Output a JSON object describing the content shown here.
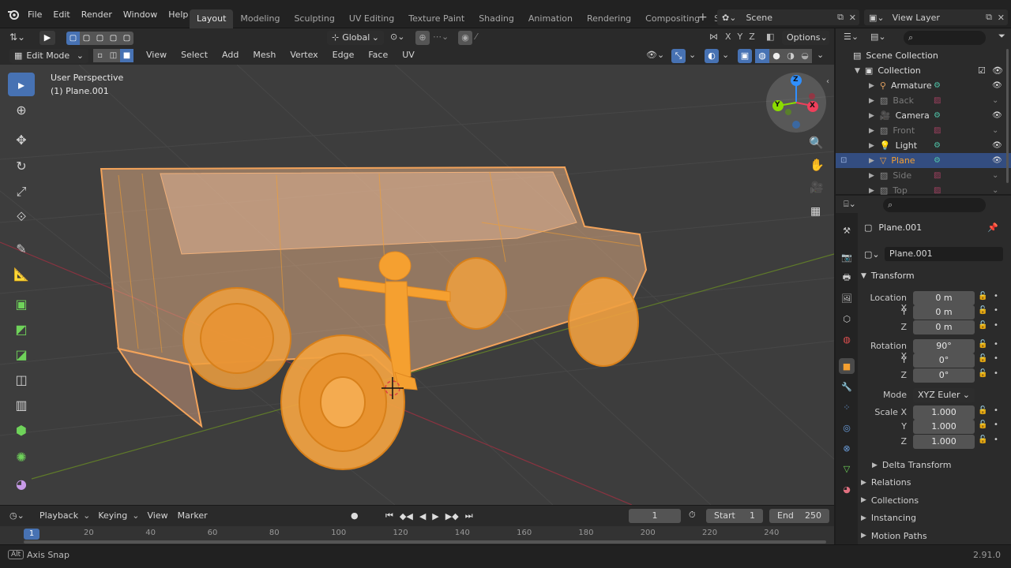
{
  "topbar": {
    "menu": [
      "File",
      "Edit",
      "Render",
      "Window",
      "Help"
    ],
    "workspaces": [
      "Layout",
      "Modeling",
      "Sculpting",
      "UV Editing",
      "Texture Paint",
      "Shading",
      "Animation",
      "Rendering",
      "Compositing",
      "Scripting"
    ],
    "active_workspace": "Layout",
    "add_workspace": "+",
    "scene_label": "Scene",
    "view_layer_label": "View Layer"
  },
  "viewport_toolbar": {
    "transform_orientation": "Global",
    "options_label": "Options",
    "axis_letters": [
      "X",
      "Y",
      "Z"
    ]
  },
  "viewport_header": {
    "mode": "Edit Mode",
    "menus": [
      "View",
      "Select",
      "Add",
      "Mesh",
      "Vertex",
      "Edge",
      "Face",
      "UV"
    ]
  },
  "viewport": {
    "perspective_label": "User Perspective",
    "object_label": "(1) Plane.001",
    "gizmo_axes": [
      "X",
      "Y",
      "Z"
    ]
  },
  "outliner": {
    "scene_collection": "Scene Collection",
    "collection": "Collection",
    "items": [
      {
        "name": "Armature",
        "icon": "armature-icon",
        "color": "#e0a060",
        "dim": false,
        "selected": false
      },
      {
        "name": "Back",
        "icon": "image-icon",
        "color": "#8a8a8a",
        "dim": true,
        "selected": false
      },
      {
        "name": "Camera",
        "icon": "camera-icon",
        "color": "#e0a060",
        "dim": false,
        "selected": false
      },
      {
        "name": "Front",
        "icon": "image-icon",
        "color": "#8a8a8a",
        "dim": true,
        "selected": false
      },
      {
        "name": "Light",
        "icon": "light-icon",
        "color": "#e0a060",
        "dim": false,
        "selected": false
      },
      {
        "name": "Plane",
        "icon": "mesh-icon",
        "color": "#f0a040",
        "dim": false,
        "selected": true
      },
      {
        "name": "Side",
        "icon": "image-icon",
        "color": "#8a8a8a",
        "dim": true,
        "selected": false
      },
      {
        "name": "Top",
        "icon": "image-icon",
        "color": "#8a8a8a",
        "dim": true,
        "selected": false
      }
    ]
  },
  "properties": {
    "object_name": "Plane.001",
    "data_name": "Plane.001",
    "transform_header": "Transform",
    "location_label": "Location X",
    "rotation_label": "Rotation X",
    "scale_label": "Scale X",
    "axis_y": "Y",
    "axis_z": "Z",
    "location": [
      "0 m",
      "0 m",
      "0 m"
    ],
    "rotation": [
      "90°",
      "0°",
      "0°"
    ],
    "mode_label": "Mode",
    "mode_value": "XYZ Euler",
    "scale": [
      "1.000",
      "1.000",
      "1.000"
    ],
    "sections": [
      "Delta Transform",
      "Relations",
      "Collections",
      "Instancing",
      "Motion Paths"
    ]
  },
  "timeline": {
    "menus": [
      "Playback",
      "Keying",
      "View",
      "Marker"
    ],
    "current_frame": "1",
    "start_label": "Start",
    "start_value": "1",
    "end_label": "End",
    "end_value": "250",
    "ruler_current": "1",
    "ruler_ticks": [
      "20",
      "40",
      "60",
      "80",
      "100",
      "120",
      "140",
      "160",
      "180",
      "200",
      "220",
      "240"
    ]
  },
  "statusbar": {
    "key": "Alt",
    "hint": "Axis Snap",
    "version": "2.91.0"
  },
  "colors": {
    "selection_orange": "#f5a030",
    "active_blue": "#4772b3",
    "outliner_selected": "#334d80",
    "axis_x_red": "#ef3f5b",
    "axis_y_green": "#8bdc00",
    "axis_z_blue": "#2f8fff"
  }
}
